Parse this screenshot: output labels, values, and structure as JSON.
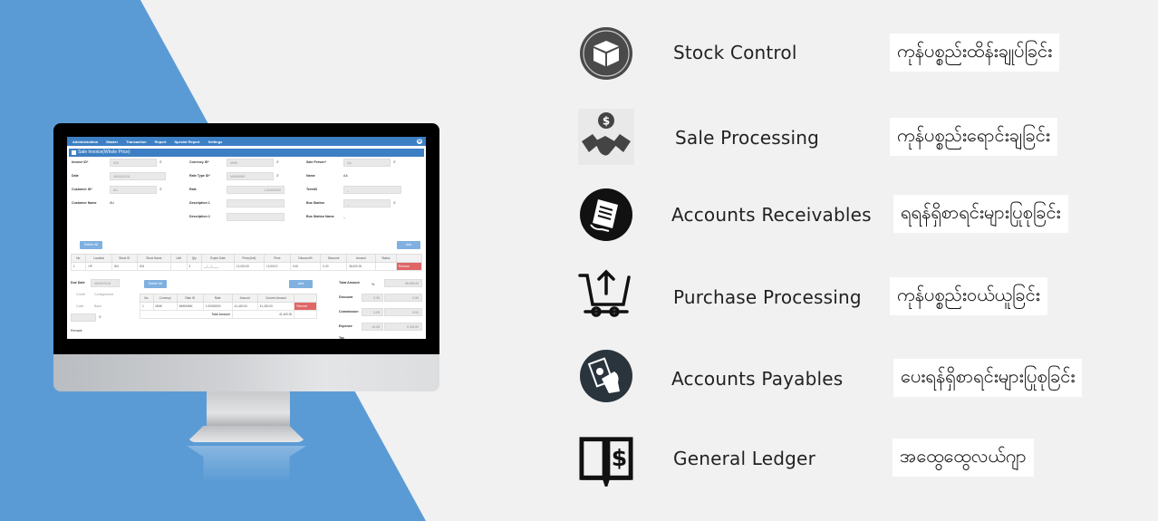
{
  "colors": {
    "background_blue": "#5b9bd5",
    "background_light": "#f1f1f1",
    "app_nav": "#3c7fc4",
    "remove_button": "#e06666"
  },
  "app": {
    "nav_items": [
      "Administration",
      "Master",
      "Transaction",
      "Report",
      "Special Report",
      "Settings"
    ],
    "panel_title": "Sale Invoice(Whole Price)",
    "form": {
      "invoice_id_label": "Invoice ID*",
      "invoice_id_value": "005",
      "date_label": "Date",
      "date_value": "08/05/2018",
      "customer_id_label": "Customer ID*",
      "customer_id_value": "AU",
      "customer_name_label": "Customer Name",
      "customer_name_value": "AU",
      "currency_id_label": "Currency ID*",
      "currency_id_value": "MMK",
      "rate_type_label": "Rate Type ID*",
      "rate_type_value": "MMKMMK",
      "rate_label": "Rate",
      "rate_value": "1.00000000",
      "desc1_label": "Description 1",
      "desc2_label": "Description 2",
      "sale_person_label": "Sale Person*",
      "sale_person_value": "AA",
      "name_label": "Name",
      "name_value": "AA",
      "term_label": "TermID",
      "term_value": "_",
      "bus_station_label": "Bus Station",
      "bus_station_value": "_",
      "bus_station_name_label": "Bus Station Name",
      "bus_station_name_value": "_"
    },
    "delete_all_label": "Delete All",
    "add_label": "Add",
    "items_table": {
      "headers": [
        "No.",
        "Location",
        "Stock ID",
        "Stock Name",
        "Unit",
        "Qty",
        "Expire Date",
        "Price(Unit)",
        "Price",
        "Discount%",
        "Discount",
        "Amount",
        "Status",
        ""
      ],
      "rows": [
        [
          "1",
          "HP",
          "004",
          "004",
          "",
          "3",
          "__/__/____",
          "12,000.00",
          "12,000.0",
          "0.00",
          "0.00",
          "36,000.00",
          "",
          "Remove"
        ]
      ]
    },
    "due_date_label": "Due Date",
    "due_date_value": "08/05/2018",
    "payment_options": [
      "Credit",
      "Consignment",
      "Cash",
      "Bank"
    ],
    "remark_label": "Remark",
    "currency_table": {
      "headers": [
        "No.",
        "Currency",
        "Rate ID",
        "Rate",
        "Amount",
        "Convert Amount",
        ""
      ],
      "rows": [
        [
          "1",
          "MMK",
          "MMKMMK",
          "1.00000000",
          "41,400.00",
          "41,400.00",
          "Remove"
        ]
      ],
      "total_label": "Total Amount",
      "total_value": "41,400.00"
    },
    "summary": [
      {
        "label": "Total Amount",
        "pct": "%",
        "value": "36,000.00"
      },
      {
        "label": "Discount",
        "pct": "0.00",
        "value": "0.00"
      },
      {
        "label": "Commission",
        "pct": "0.00",
        "value": "0.00"
      },
      {
        "label": "Expense",
        "pct": "10.25",
        "value": "3,700.00"
      },
      {
        "label": "Tax",
        "pct": "",
        "value": ""
      }
    ]
  },
  "features": [
    {
      "icon": "box-icon",
      "en": "Stock Control",
      "mm": "ကုန်ပစ္စည်းထိန်းချုပ်ခြင်း"
    },
    {
      "icon": "handshake-dollar-icon",
      "en": "Sale Processing",
      "mm": "ကုန်ပစ္စည်းရောင်းချခြင်း"
    },
    {
      "icon": "receipt-icon",
      "en": "Accounts Receivables",
      "mm": "ရရန်ရှိစာရင်းများပြုစုခြင်း"
    },
    {
      "icon": "cart-upload-icon",
      "en": "Purchase Processing",
      "mm": "ကုန်ပစ္စည်းဝယ်ယူခြင်း"
    },
    {
      "icon": "hand-money-icon",
      "en": "Accounts Payables",
      "mm": "ပေးရန်ရှိစာရင်းများပြုစုခြင်း"
    },
    {
      "icon": "ledger-book-icon",
      "en": "General Ledger",
      "mm": "အထွေထွေလယ်ဂျာ"
    }
  ]
}
